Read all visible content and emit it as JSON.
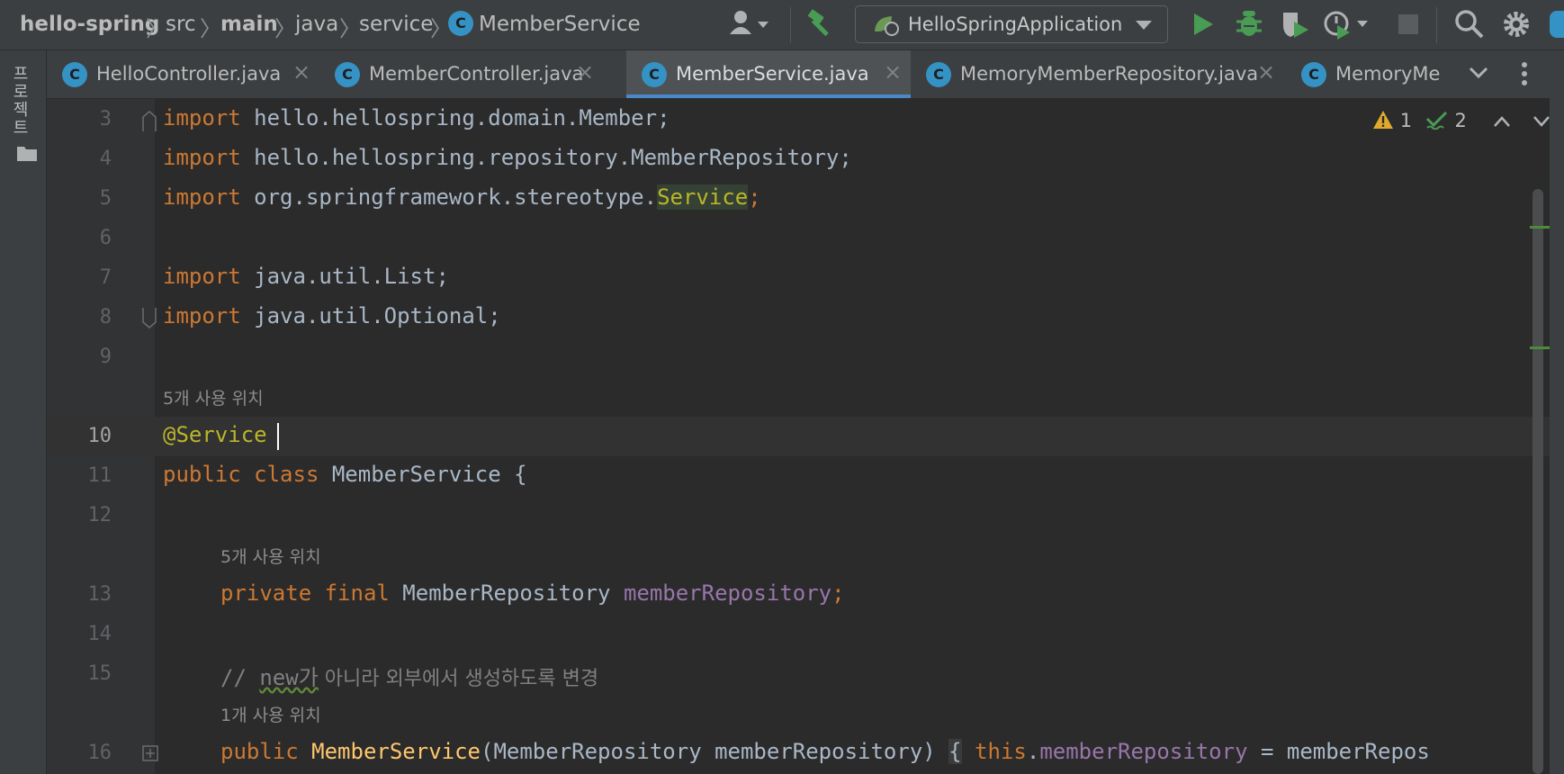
{
  "breadcrumbs": [
    "hello-spring",
    "src",
    "main",
    "java",
    "service",
    "MemberService"
  ],
  "run_config": "HelloSpringApplication",
  "left_tool_label": "프로젝트",
  "tabs": [
    {
      "label": "HelloController.java",
      "icon": "class-icon",
      "active": false
    },
    {
      "label": "MemberController.java",
      "icon": "class-icon",
      "active": false
    },
    {
      "label": "MemberService.java",
      "icon": "class-icon",
      "active": true
    },
    {
      "label": "MemoryMemberRepository.java",
      "icon": "class-icon",
      "active": false
    },
    {
      "label": "MemoryMe",
      "icon": "class-icon",
      "active": false
    }
  ],
  "icon_glyph": "C",
  "close_glyph": "×",
  "inspections": {
    "warnings": "1",
    "ok": "2"
  },
  "line_numbers": [
    "3",
    "4",
    "5",
    "6",
    "7",
    "8",
    "9",
    "10",
    "11",
    "12",
    "13",
    "14",
    "15",
    "16"
  ],
  "current_line": "10",
  "code": {
    "l3_kw": "import",
    "l3_rest": " hello.hellospring.domain.Member;",
    "l4_kw": "import",
    "l4_rest": " hello.hellospring.repository.MemberRepository;",
    "l5_kw": "import",
    "l5_pkg": " org.springframework.stereotype.",
    "l5_cls": "Service",
    "l5_end": ";",
    "l7_kw": "import",
    "l7_rest": " java.util.List;",
    "l8_kw": "import",
    "l8_rest": " java.util.Optional;",
    "hint_usages_class": "5개 사용 위치",
    "l10_ann": "@Service",
    "l11_kw": "public class",
    "l11_rest": " MemberService {",
    "hint_usages_field": "5개 사용 위치",
    "l13_kw": "private final",
    "l13_type": " MemberRepository ",
    "l13_field": "memberRepository",
    "l13_end": ";",
    "l15_cmt_a": "// ",
    "l15_cmt_new": "new가",
    "l15_cmt_b": " 아니라 외부에서 생성하도록 변경",
    "hint_usages_ctor": "1개 사용 위치",
    "l16_kw": "public",
    "l16_mth": " MemberService",
    "l16_params": "(MemberRepository memberRepository) ",
    "l16_brace": "{",
    "l16_this": " this",
    "l16_dot": ".",
    "l16_field": "memberRepository",
    "l16_rest": " = memberRepos"
  },
  "colors": {
    "keyword": "#cc7832",
    "annotation": "#bbb529",
    "field": "#9876aa",
    "method": "#ffc66d",
    "text": "#a9b7c6",
    "accent": "#4a88c7"
  }
}
